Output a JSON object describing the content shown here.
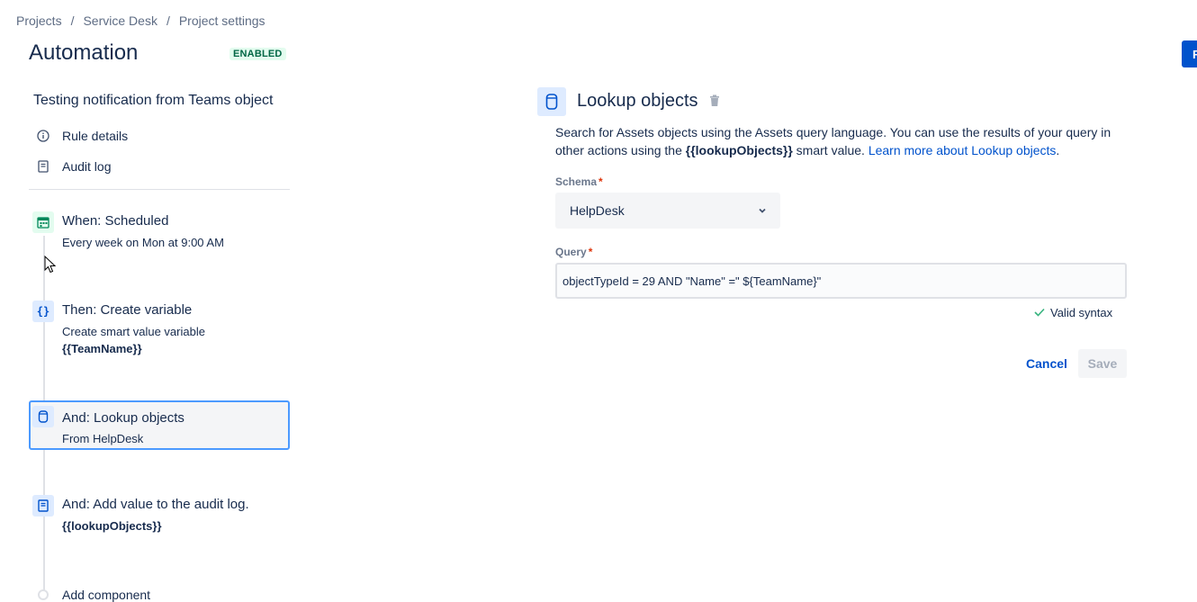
{
  "breadcrumb": [
    "Projects",
    "Service Desk",
    "Project settings"
  ],
  "page": {
    "title": "Automation",
    "status_badge": "ENABLED",
    "top_right_button": "R"
  },
  "rule": {
    "name": "Testing notification from Teams object",
    "links": {
      "details": "Rule details",
      "audit": "Audit log"
    },
    "steps": [
      {
        "title": "When: Scheduled",
        "subtitle": "Every week on Mon at 9:00 AM",
        "icon": "calendar-icon"
      },
      {
        "title": "Then: Create variable",
        "subtitle": "Create smart value variable",
        "bold": "{{TeamName}}",
        "icon": "braces-icon"
      },
      {
        "title": "And: Lookup objects",
        "subtitle": "From HelpDesk",
        "icon": "database-icon",
        "selected": true
      },
      {
        "title": "And: Add value to the audit log.",
        "bold": "{{lookupObjects}}",
        "icon": "audit-log-icon"
      }
    ],
    "add_component": "Add component"
  },
  "panel": {
    "title": "Lookup objects",
    "desc_part1": "Search for Assets objects using the Assets query language. You can use the results of your query in other actions using the ",
    "desc_bold": "{{lookupObjects}}",
    "desc_part2": " smart value. ",
    "desc_link": "Learn more about Lookup objects",
    "desc_end": ".",
    "schema_label": "Schema",
    "schema_value": "HelpDesk",
    "query_label": "Query",
    "query_value": "objectTypeId = 29 AND \"Name\" =\" ${TeamName}\"",
    "required_mark": "*",
    "valid_text": "Valid syntax",
    "cancel_label": "Cancel",
    "save_label": "Save"
  },
  "colors": {
    "accent": "#0052cc",
    "success": "#36b37e",
    "badge_bg": "#e3fcef",
    "badge_text": "#006644",
    "selected_border": "#4c9aff"
  }
}
